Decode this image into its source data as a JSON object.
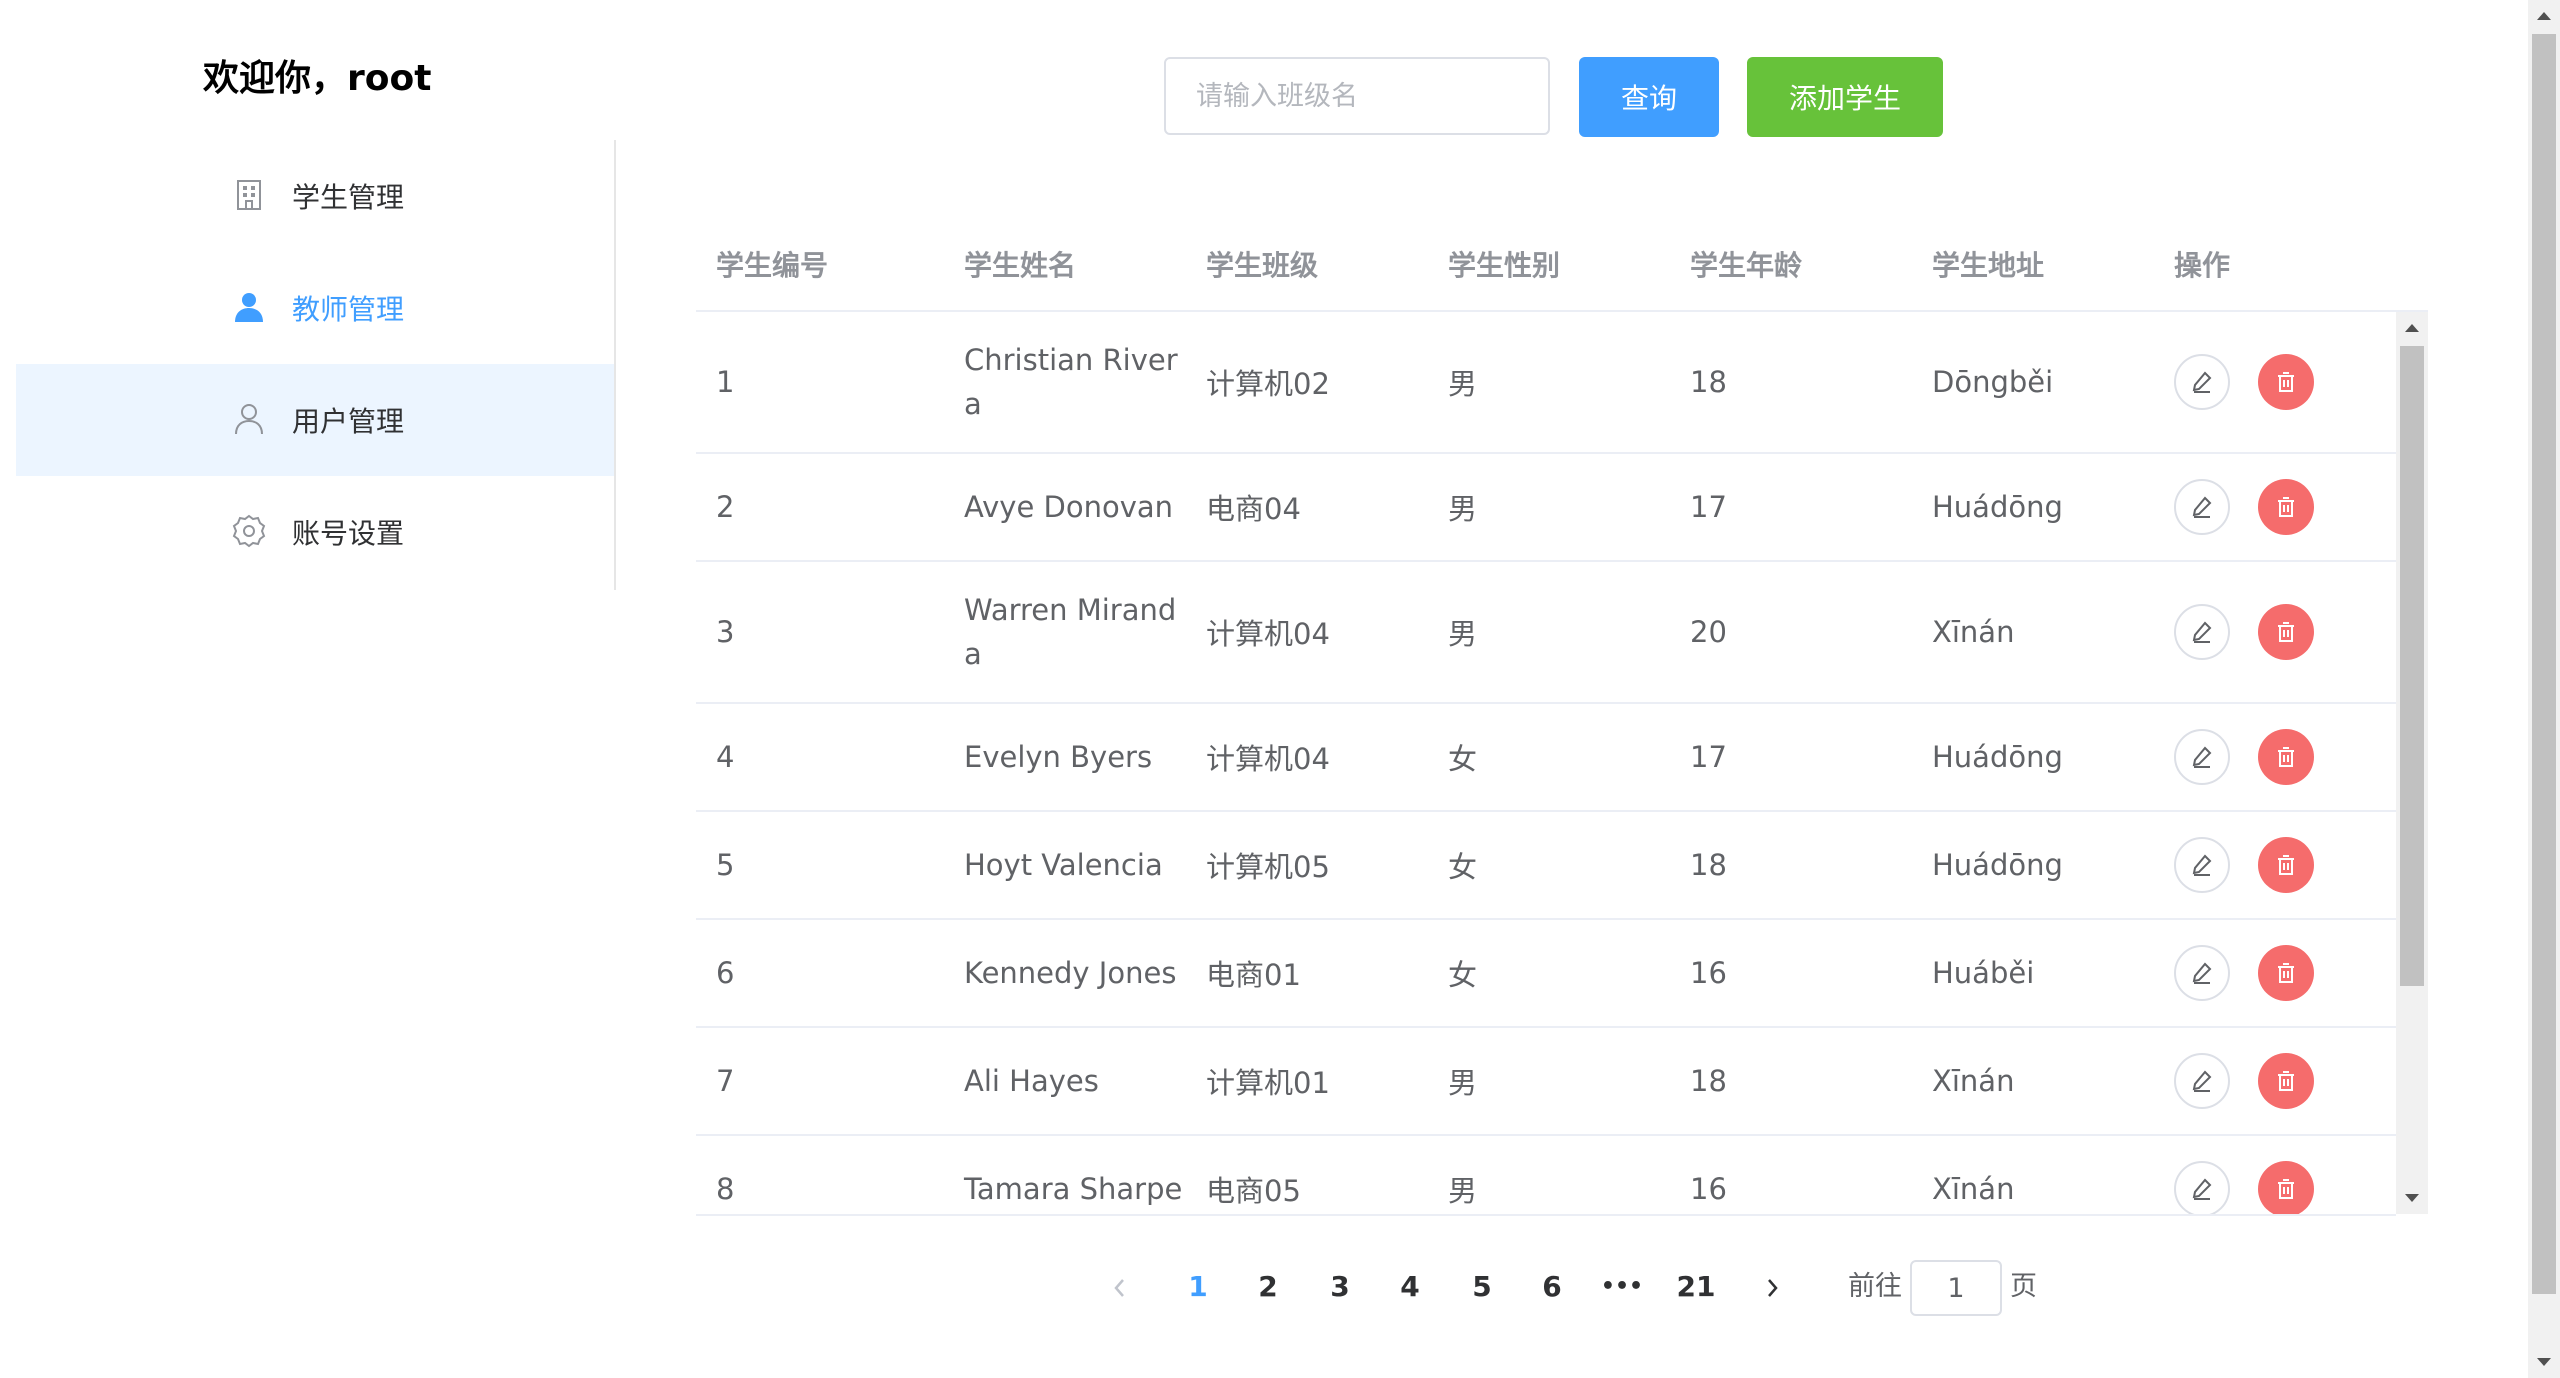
{
  "header": {
    "welcome": "欢迎你，root"
  },
  "sidebar": {
    "items": [
      {
        "label": "学生管理",
        "icon": "office-building-icon",
        "active": false
      },
      {
        "label": "教师管理",
        "icon": "user-solid-icon",
        "active": true
      },
      {
        "label": "用户管理",
        "icon": "user-icon",
        "active": false
      },
      {
        "label": "账号设置",
        "icon": "setting-icon",
        "active": false
      }
    ]
  },
  "toolbar": {
    "search_placeholder": "请输入班级名",
    "search_value": "",
    "query_label": "查询",
    "add_label": "添加学生"
  },
  "table": {
    "columns": [
      "学生编号",
      "学生姓名",
      "学生班级",
      "学生性别",
      "学生年龄",
      "学生地址",
      "操作"
    ],
    "rows": [
      {
        "id": "1",
        "name": "Christian Rivera",
        "class": "计算机02",
        "gender": "男",
        "age": "18",
        "address": "Dōngběi"
      },
      {
        "id": "2",
        "name": "Avye Donovan",
        "class": "电商04",
        "gender": "男",
        "age": "17",
        "address": "Huádōng"
      },
      {
        "id": "3",
        "name": "Warren Miranda",
        "class": "计算机04",
        "gender": "男",
        "age": "20",
        "address": "Xīnán"
      },
      {
        "id": "4",
        "name": "Evelyn Byers",
        "class": "计算机04",
        "gender": "女",
        "age": "17",
        "address": "Huádōng"
      },
      {
        "id": "5",
        "name": "Hoyt Valencia",
        "class": "计算机05",
        "gender": "女",
        "age": "18",
        "address": "Huádōng"
      },
      {
        "id": "6",
        "name": "Kennedy Jones",
        "class": "电商01",
        "gender": "女",
        "age": "16",
        "address": "Huáběi"
      },
      {
        "id": "7",
        "name": "Ali Hayes",
        "class": "计算机01",
        "gender": "男",
        "age": "18",
        "address": "Xīnán"
      },
      {
        "id": "8",
        "name": "Tamara Sharpe",
        "class": "电商05",
        "gender": "男",
        "age": "16",
        "address": "Xīnán"
      }
    ]
  },
  "pagination": {
    "pages": [
      "1",
      "2",
      "3",
      "4",
      "5",
      "6",
      "•••",
      "21"
    ],
    "current": "1",
    "goto_label": "前往",
    "goto_value": "1",
    "page_suffix": "页"
  },
  "colors": {
    "primary": "#409eff",
    "success": "#67c23a",
    "danger": "#f56c6c",
    "active_menu_bg": "#ecf5ff"
  }
}
